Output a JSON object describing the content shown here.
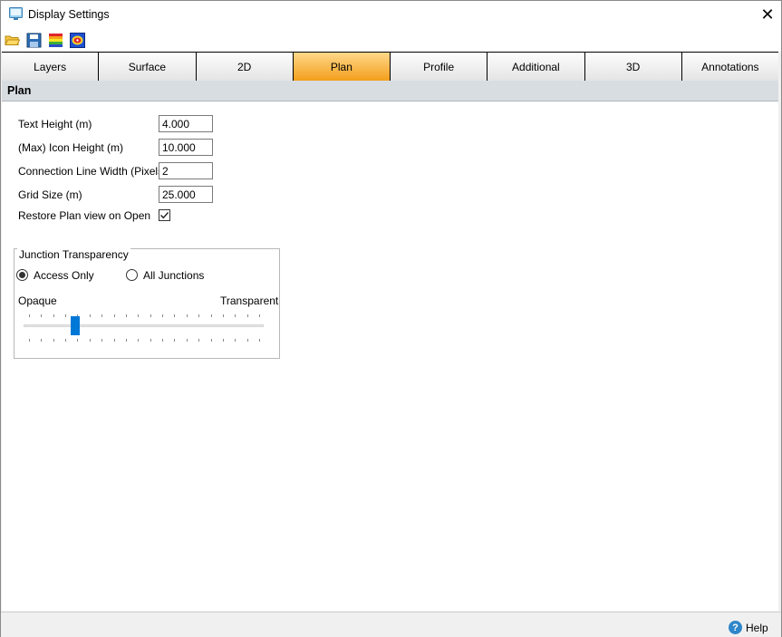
{
  "window": {
    "title": "Display Settings"
  },
  "toolbar": {
    "icons": [
      "open-folder-icon",
      "save-icon",
      "color-palette-icon",
      "color-map-icon"
    ]
  },
  "tabs": [
    {
      "label": "Layers"
    },
    {
      "label": "Surface"
    },
    {
      "label": "2D"
    },
    {
      "label": "Plan",
      "active": true
    },
    {
      "label": "Profile"
    },
    {
      "label": "Additional"
    },
    {
      "label": "3D"
    },
    {
      "label": "Annotations"
    }
  ],
  "section": {
    "title": "Plan"
  },
  "fields": {
    "text_height": {
      "label": "Text Height (m)",
      "value": "4.000"
    },
    "icon_height": {
      "label": "(Max) Icon Height (m)",
      "value": "10.000"
    },
    "line_width": {
      "label": "Connection Line Width (Pixels)",
      "value": "2"
    },
    "grid_size": {
      "label": "Grid Size (m)",
      "value": "25.000"
    },
    "restore": {
      "label": "Restore Plan view on Open",
      "checked": true
    }
  },
  "junction": {
    "title": "Junction Transparency",
    "options": [
      {
        "label": "Access Only",
        "selected": true
      },
      {
        "label": "All Junctions",
        "selected": false
      }
    ],
    "slider": {
      "min_label": "Opaque",
      "max_label": "Transparent",
      "level": 0.2
    }
  },
  "status": {
    "help_label": "Help"
  },
  "colors": {
    "active_tab": "#f39f1c",
    "slider_thumb": "#0078d7",
    "header_bg": "#d8dde2"
  }
}
